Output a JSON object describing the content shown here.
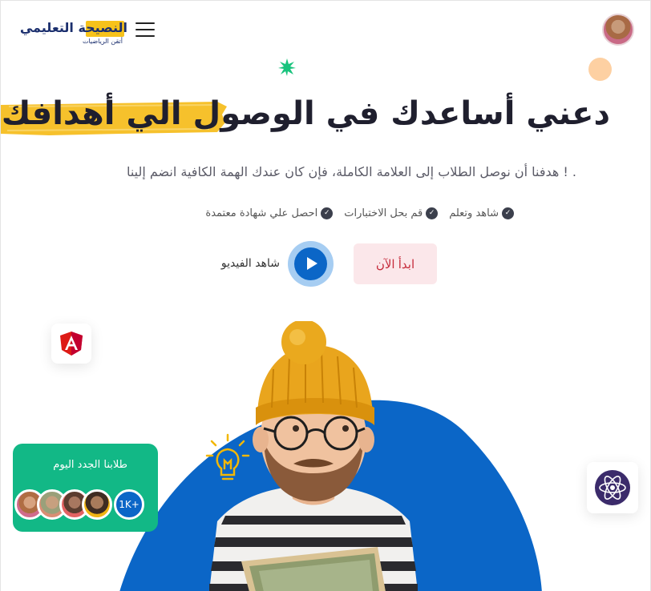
{
  "header": {
    "logo_title": "النصيحة التعليمي",
    "logo_subtitle": "أتقن الرياضيات",
    "menu_icon": "hamburger-menu-icon",
    "user_avatar": "user-avatar"
  },
  "hero": {
    "headline": "دعني أساعدك في الوصول الي أهدافك",
    "subtitle": ". ! هدفنا أن نوصل الطلاب إلى العلامة الكاملة، فإن كان عندك الهمة الكافية انضم إلينا",
    "features": [
      {
        "label": "شاهد وتعلم",
        "icon": "check-badge-icon"
      },
      {
        "label": "قم بحل الاختبارات",
        "icon": "check-badge-icon"
      },
      {
        "label": "احصل علي شهادة معتمدة",
        "icon": "check-badge-icon"
      }
    ],
    "start_button": "ابدأ الآن",
    "video_label": "شاهد الفيديو"
  },
  "students_card": {
    "title": "طلابنا الجدد اليوم",
    "count": "1K+"
  },
  "colors": {
    "brand_blue": "#0b66c7",
    "accent_yellow": "#f7c21a",
    "card_green": "#12b886",
    "start_btn_bg": "#fbe7ea",
    "start_btn_text": "#c62b3b"
  },
  "icons": [
    "angular-icon",
    "atom-icon",
    "lightbulb-icon",
    "play-icon",
    "sparkle-star-icon"
  ]
}
